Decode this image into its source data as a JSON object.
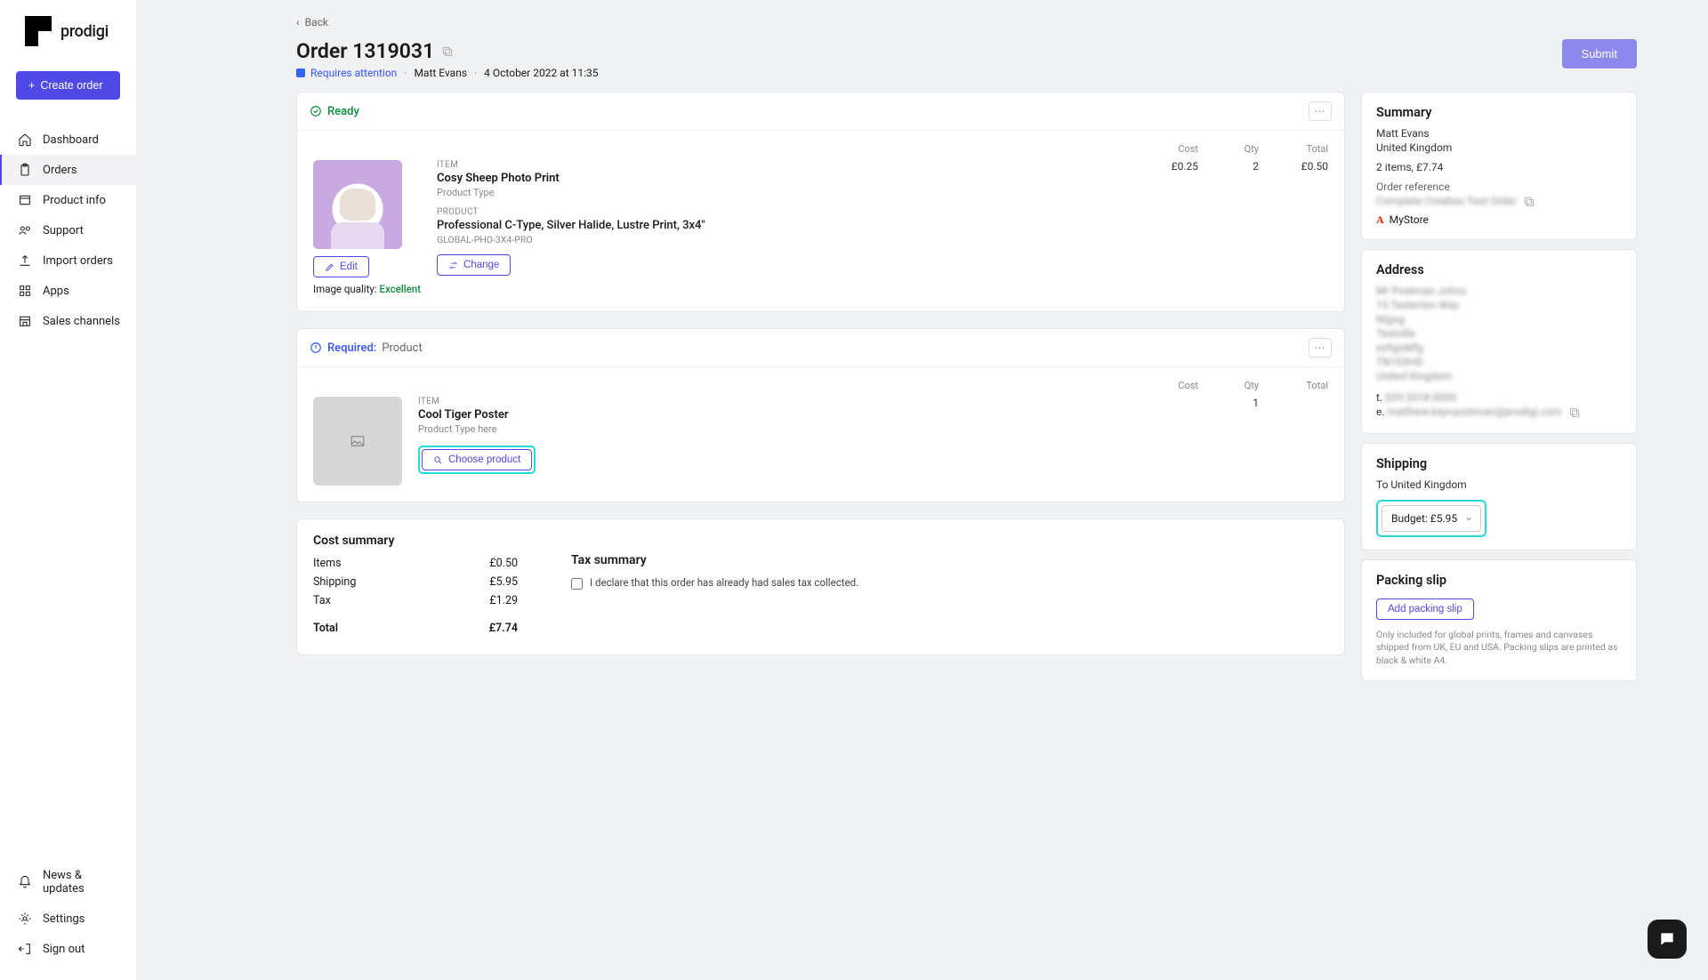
{
  "brand": "prodigi",
  "create_label": "Create order",
  "nav": {
    "dashboard": "Dashboard",
    "orders": "Orders",
    "product_info": "Product info",
    "support": "Support",
    "import_orders": "Import orders",
    "apps": "Apps",
    "sales_channels": "Sales channels",
    "news": "News & updates",
    "settings": "Settings",
    "sign_out": "Sign out"
  },
  "back": "Back",
  "title": "Order 1319031",
  "status": "Requires attention",
  "customer": "Matt Evans",
  "timestamp": "4 October 2022 at 11:35",
  "submit": "Submit",
  "ready_label": "Ready",
  "required_prefix": "Required:",
  "required_what": "Product",
  "cols": {
    "item": "ITEM",
    "product": "PRODUCT",
    "cost": "Cost",
    "qty": "Qty",
    "total": "Total"
  },
  "item1": {
    "name": "Cosy Sheep Photo Print",
    "type": "Product Type",
    "product": "Professional C-Type, Silver Halide, Lustre Print, 3x4\"",
    "sku": "GLOBAL-PHO-3X4-PRO",
    "cost": "£0.25",
    "qty": "2",
    "total": "£0.50",
    "edit": "Edit",
    "change": "Change",
    "iq_label": "Image quality: ",
    "iq_val": "Excellent"
  },
  "item2": {
    "name": "Cool Tiger Poster",
    "type": "Product Type here",
    "qty": "1",
    "choose": "Choose product"
  },
  "cost": {
    "heading": "Cost summary",
    "items_l": "Items",
    "items_v": "£0.50",
    "ship_l": "Shipping",
    "ship_v": "£5.95",
    "tax_l": "Tax",
    "tax_v": "£1.29",
    "total_l": "Total",
    "total_v": "£7.74",
    "tax_heading": "Tax summary",
    "tax_note": "I declare that this order has already had sales tax collected."
  },
  "summary": {
    "heading": "Summary",
    "name": "Matt Evans",
    "country": "United Kingdom",
    "items": "2 items, £7.74",
    "ref_label": "Order reference",
    "ref_value": "Complete Creation Test Order",
    "store": "MyStore"
  },
  "address": {
    "heading": "Address",
    "lines": [
      "Mr Postman Johns",
      "15 Testerton Way",
      "Nigog",
      "Testville",
      "xx9gsMfg",
      "TN103HD",
      "United Kingdom"
    ],
    "phone_l": "t.",
    "phone_v": "029 2018 0000",
    "email_l": "e.",
    "email_v": "matthew.kay+postman@prodigi.com"
  },
  "shipping": {
    "heading": "Shipping",
    "to": "To United Kingdom",
    "selected": "Budget: £5.95"
  },
  "packing": {
    "heading": "Packing slip",
    "btn": "Add packing slip",
    "note": "Only included for global prints, frames and canvases shipped from UK, EU and USA. Packing slips are printed as black & white A4."
  }
}
